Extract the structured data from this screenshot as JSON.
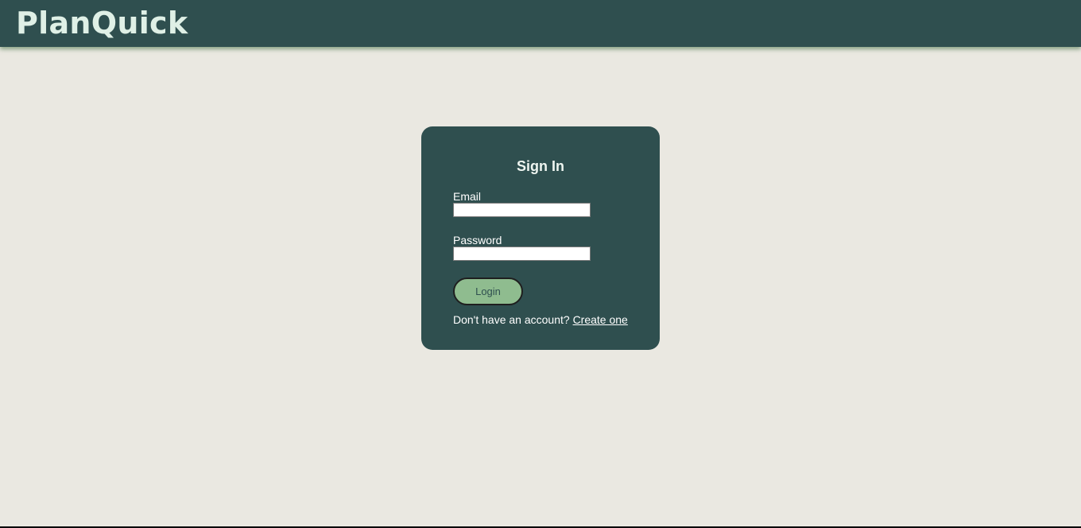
{
  "header": {
    "brand": "PlanQuick"
  },
  "login": {
    "title": "Sign In",
    "email_label": "Email",
    "email_value": "",
    "password_label": "Password",
    "password_value": "",
    "login_button": "Login",
    "no_account_text": "Don't have an account?",
    "create_link": "Create one"
  },
  "colors": {
    "header_bg": "#2f4f4f",
    "page_bg": "#eae8e1",
    "card_bg": "#2f4f4f",
    "button_bg": "#8fbc8f",
    "brand_text": "#dff0e6"
  }
}
